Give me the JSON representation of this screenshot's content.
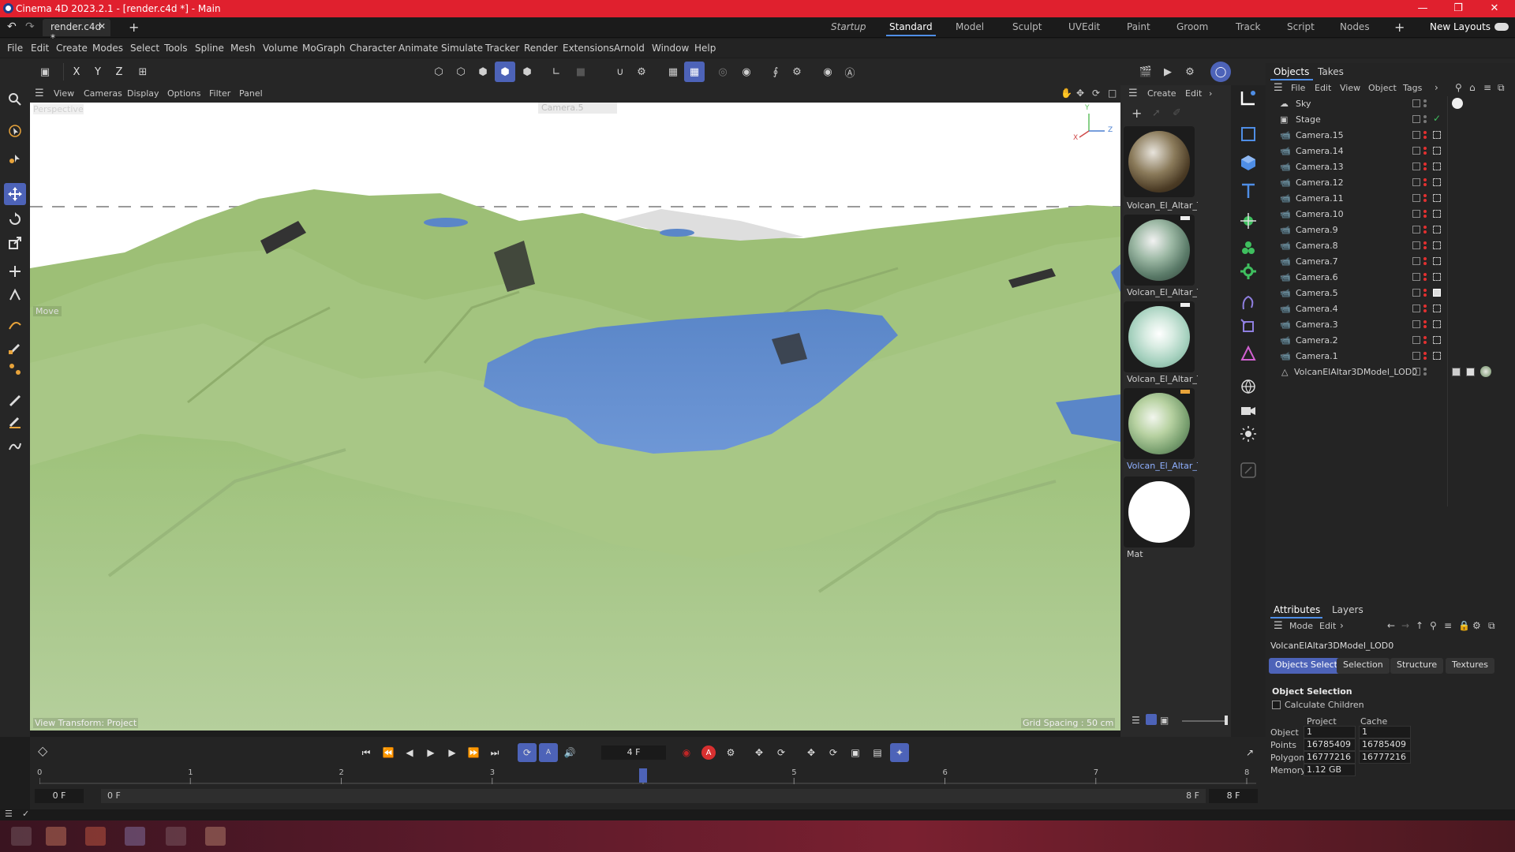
{
  "window": {
    "title": "Cinema 4D 2023.2.1 - [render.c4d *] - Main",
    "min_icon": "minimize-icon",
    "max_icon": "maximize-icon",
    "close_icon": "close-icon"
  },
  "tabs": {
    "file_tab": "render.c4d *",
    "layouts": [
      "Startup",
      "Standard",
      "Model",
      "Sculpt",
      "UVEdit",
      "Paint",
      "Groom",
      "Track",
      "Script",
      "Nodes"
    ],
    "active_layout": "Standard",
    "new_layouts": "New Layouts"
  },
  "menu": [
    "File",
    "Edit",
    "Create",
    "Modes",
    "Select",
    "Tools",
    "Spline",
    "Mesh",
    "Volume",
    "MoGraph",
    "Character",
    "Animate",
    "Simulate",
    "Tracker",
    "Render",
    "Extensions",
    "Arnold",
    "Window",
    "Help"
  ],
  "toolbar": {
    "axis_x": "X",
    "axis_y": "Y",
    "axis_z": "Z"
  },
  "viewport": {
    "menu": [
      "View",
      "Cameras",
      "Display",
      "Options",
      "Filter",
      "Panel"
    ],
    "view_name": "Perspective",
    "camera_name": "Camera.5",
    "tool_label": "Move",
    "view_transform": "View Transform: Project",
    "grid_spacing": "Grid Spacing : 50 cm",
    "axis_labels": [
      "Y",
      "X",
      "Z"
    ]
  },
  "material_manager": {
    "menu": [
      "Create",
      "Edit"
    ],
    "materials": [
      {
        "label": "Volcan_El_Altar_Te"
      },
      {
        "label": "Volcan_El_Altar_Te"
      },
      {
        "label": "Volcan_El_Altar_Te"
      },
      {
        "label": "Volcan_El_Altar_Te"
      },
      {
        "label": "Mat"
      }
    ]
  },
  "objects_panel": {
    "tabs": [
      "Objects",
      "Takes"
    ],
    "menu": [
      "File",
      "Edit",
      "View",
      "Object",
      "Tags"
    ],
    "items": [
      {
        "name": "Sky",
        "icon": "sky-icon"
      },
      {
        "name": "Stage",
        "icon": "stage-icon"
      },
      {
        "name": "Camera.15",
        "icon": "camera-icon"
      },
      {
        "name": "Camera.14",
        "icon": "camera-icon"
      },
      {
        "name": "Camera.13",
        "icon": "camera-icon"
      },
      {
        "name": "Camera.12",
        "icon": "camera-icon"
      },
      {
        "name": "Camera.11",
        "icon": "camera-icon"
      },
      {
        "name": "Camera.10",
        "icon": "camera-icon"
      },
      {
        "name": "Camera.9",
        "icon": "camera-icon"
      },
      {
        "name": "Camera.8",
        "icon": "camera-icon"
      },
      {
        "name": "Camera.7",
        "icon": "camera-icon"
      },
      {
        "name": "Camera.6",
        "icon": "camera-icon"
      },
      {
        "name": "Camera.5",
        "icon": "camera-icon"
      },
      {
        "name": "Camera.4",
        "icon": "camera-icon"
      },
      {
        "name": "Camera.3",
        "icon": "camera-icon"
      },
      {
        "name": "Camera.2",
        "icon": "camera-icon"
      },
      {
        "name": "Camera.1",
        "icon": "camera-icon"
      },
      {
        "name": "VolcanElAltar3DModel_LOD0",
        "icon": "polygon-object-icon"
      }
    ]
  },
  "attributes": {
    "tabs": [
      "Attributes",
      "Layers"
    ],
    "menu": [
      "Mode",
      "Edit"
    ],
    "object_name": "VolcanElAltar3DModel_LOD0",
    "subtabs": [
      "Objects Selection",
      "Selection",
      "Structure",
      "Textures"
    ],
    "active_subtab": "Objects Selection",
    "section_title": "Object Selection",
    "calculate_children": "Calculate Children",
    "col_project": "Project",
    "col_cache": "Cache",
    "rows": [
      {
        "label": "Object",
        "project": "1",
        "cache": "1"
      },
      {
        "label": "Points",
        "project": "16785409",
        "cache": "16785409"
      },
      {
        "label": "Polygons",
        "project": "16777216",
        "cache": "16777216"
      },
      {
        "label": "Memory",
        "project": "1.12 GB",
        "cache": ""
      }
    ]
  },
  "timeline": {
    "current_frame": "4 F",
    "current_frame_value": 4,
    "ruler_labels": [
      "0",
      "1",
      "2",
      "3",
      "4",
      "5",
      "6",
      "7",
      "8"
    ],
    "start_frame": "0 F",
    "range_start": "0 F",
    "range_end": "8 F",
    "end_frame": "8 F"
  }
}
